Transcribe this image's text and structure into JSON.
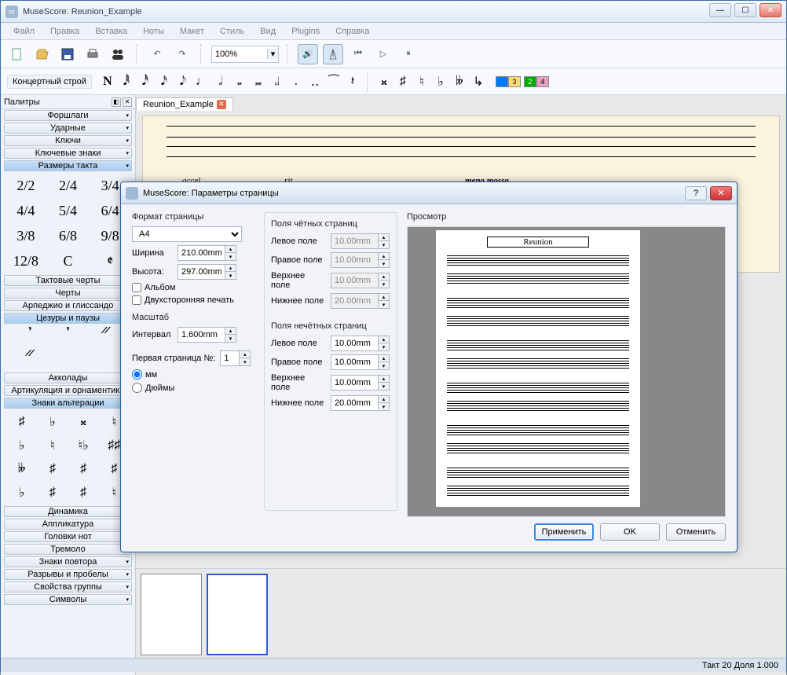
{
  "window": {
    "title": "MuseScore: Reunion_Example"
  },
  "menu": [
    "Файл",
    "Правка",
    "Вставка",
    "Ноты",
    "Макет",
    "Стиль",
    "Вид",
    "Plugins",
    "Справка"
  ],
  "toolbar": {
    "zoom": "100%"
  },
  "toolbar2": {
    "label": "Концертный строй",
    "voice_top": [
      "3"
    ],
    "voice_bot": [
      "2",
      "4"
    ]
  },
  "sidebar": {
    "header": "Палитры",
    "buttons_above": [
      "Форшлаги",
      "Ударные",
      "Ключи",
      "Ключевые знаки",
      "Размеры такта"
    ],
    "timesig": [
      "2/2",
      "2/4",
      "3/4",
      "4/4",
      "5/4",
      "6/4",
      "3/8",
      "6/8",
      "9/8",
      "12/8",
      "C",
      "𝄵"
    ],
    "buttons_mid": [
      "Тактовые черты",
      "Черты",
      "Арпеджио и глиссандо",
      "Цезуры и паузы"
    ],
    "pauses": [
      "𝄒",
      "𝄒",
      "𝄓",
      "𝄓"
    ],
    "buttons_low": [
      "Акколады",
      "Артикуляция и орнаментика",
      "Знаки альтерации"
    ],
    "accidentals": [
      "♯",
      "♭",
      "𝄪",
      "♮",
      "♭",
      "♮",
      "♮♭",
      "♯♯",
      "𝄫",
      "♯",
      "♯",
      "♯",
      "♭",
      "♯",
      "♯",
      "♮"
    ],
    "buttons_bot": [
      "Динамика",
      "Аппликатура",
      "Головки нот",
      "Тремоло",
      "Знаки повтора",
      "Разрывы и пробелы",
      "Свойства группы",
      "Символы"
    ]
  },
  "doc": {
    "tabname": "Reunion_Example",
    "tempo1": "accel.",
    "tempo2": "rit.",
    "tempo3": "meno mosso"
  },
  "dialog": {
    "title": "MuseScore: Параметры страницы",
    "format_hdr": "Формат страницы",
    "paper": "A4",
    "width_lbl": "Ширина",
    "width": "210.00mm",
    "height_lbl": "Высота:",
    "height": "297.00mm",
    "album": "Альбом",
    "duplex": "Двухсторонняя печать",
    "scale_hdr": "Масштаб",
    "interval_lbl": "Интервал",
    "interval": "1.600mm",
    "firstpg_lbl": "Первая страница №:",
    "firstpg": "1",
    "mm": "мм",
    "inch": "Дюймы",
    "even_hdr": "Поля чётных страниц",
    "odd_hdr": "Поля нечётных страниц",
    "left_lbl": "Левое поле",
    "right_lbl": "Правое поле",
    "top_lbl": "Верхнее поле",
    "bot_lbl": "Нижнее поле",
    "even": {
      "left": "10.00mm",
      "right": "10.00mm",
      "top": "10.00mm",
      "bot": "20.00mm"
    },
    "odd": {
      "left": "10.00mm",
      "right": "10.00mm",
      "top": "10.00mm",
      "bot": "20.00mm"
    },
    "preview_hdr": "Просмотр",
    "preview_title": "Reunion",
    "apply": "Применить",
    "ok": "OK",
    "cancel": "Отменить"
  },
  "status": "Такт  20 Доля  1.000"
}
